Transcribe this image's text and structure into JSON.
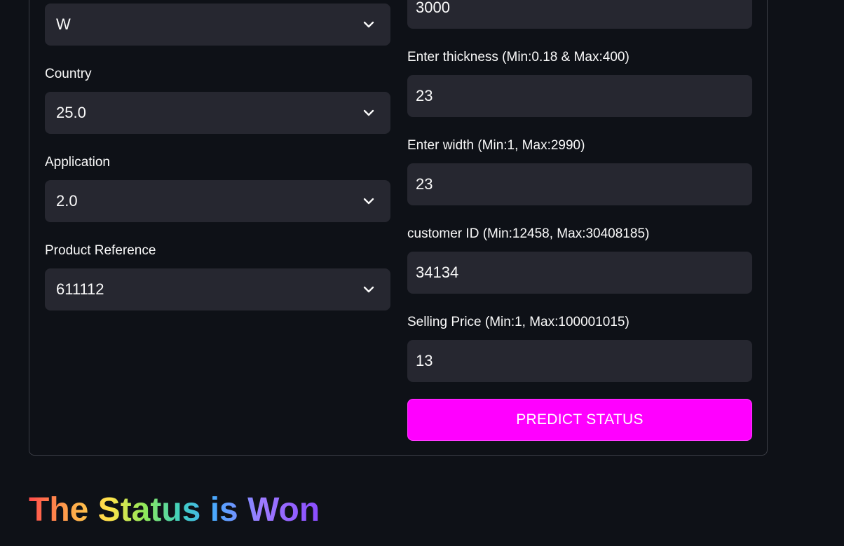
{
  "left_column": {
    "first_select": {
      "value": "W"
    },
    "country": {
      "label": "Country",
      "value": "25.0"
    },
    "application": {
      "label": "Application",
      "value": "2.0"
    },
    "product_reference": {
      "label": "Product Reference",
      "value": "611112"
    }
  },
  "right_column": {
    "first_input": {
      "value": "3000"
    },
    "thickness": {
      "label": "Enter thickness (Min:0.18 & Max:400)",
      "value": "23"
    },
    "width": {
      "label": "Enter width (Min:1, Max:2990)",
      "value": "23"
    },
    "customer_id": {
      "label": "customer ID (Min:12458, Max:30408185)",
      "value": "34134"
    },
    "selling_price": {
      "label": "Selling Price (Min:1, Max:100001015)",
      "value": "13"
    },
    "predict_button": {
      "label": "PREDICT STATUS"
    }
  },
  "result": {
    "text": "The Status is Won"
  },
  "colors": {
    "background": "#0e1117",
    "field": "#262730",
    "button": "#ff00ff"
  },
  "icons": {
    "select_chevron": "chevron-down-icon"
  }
}
